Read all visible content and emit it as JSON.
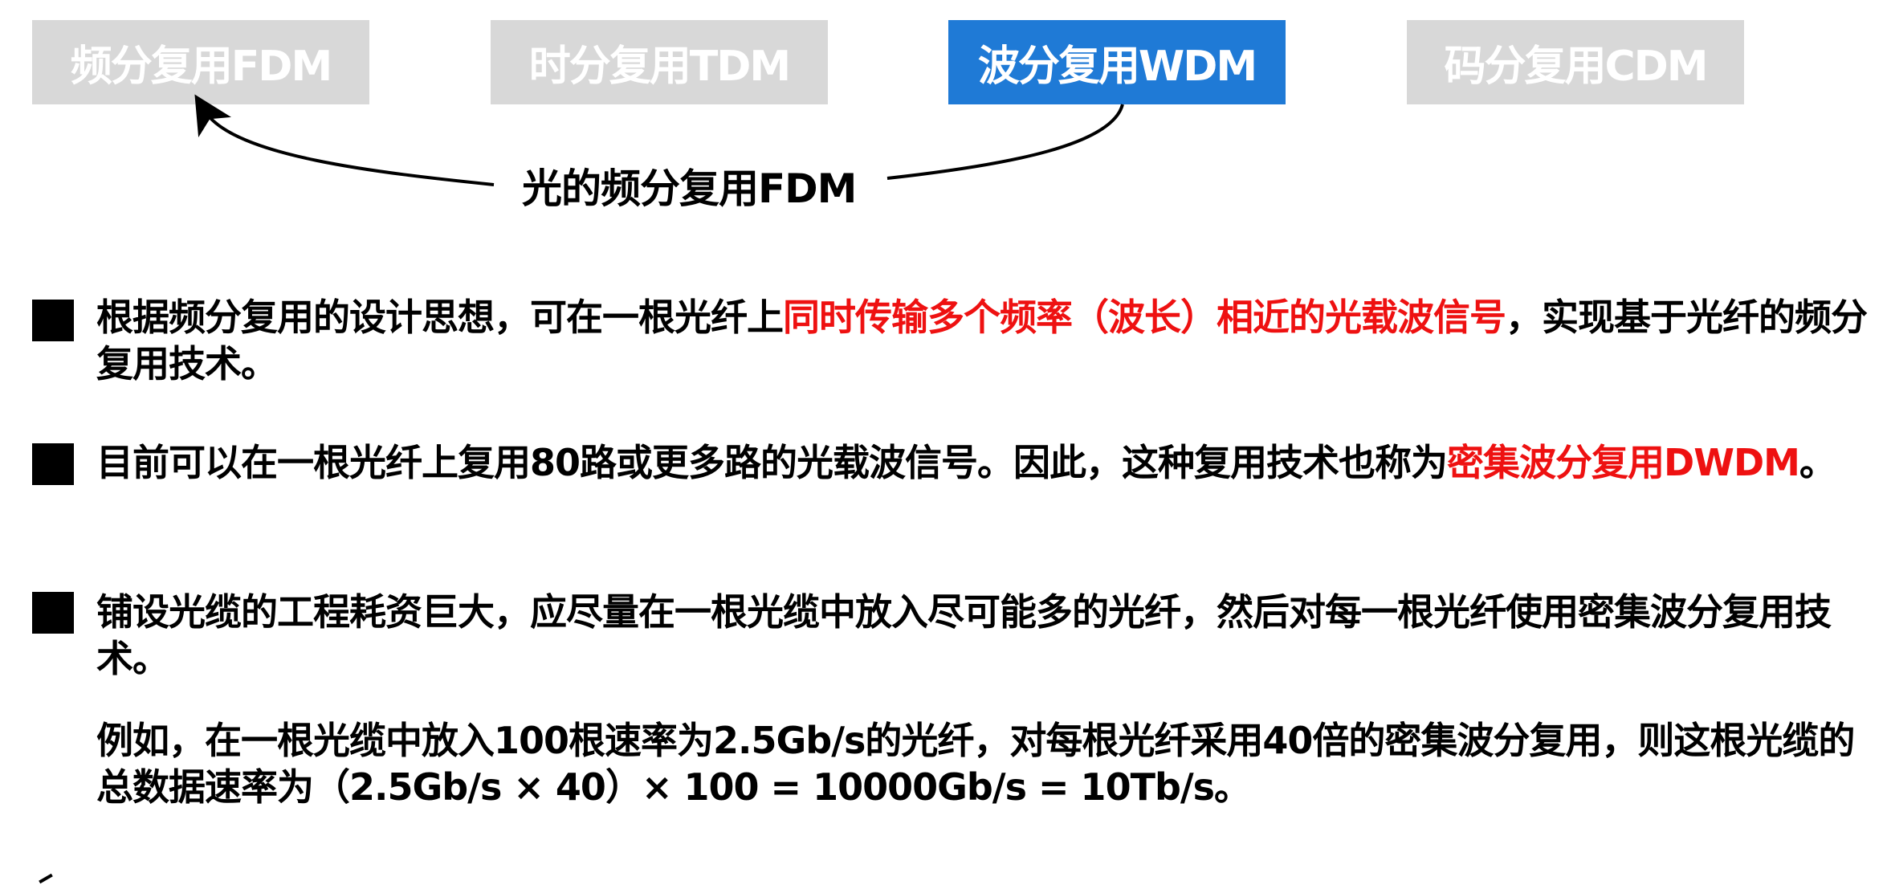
{
  "tabs": [
    {
      "label": "频分复用FDM",
      "active": false
    },
    {
      "label": "时分复用TDM",
      "active": false
    },
    {
      "label": "波分复用WDM",
      "active": true
    },
    {
      "label": "码分复用CDM",
      "active": false
    }
  ],
  "arrow_label": "光的频分复用FDM",
  "colors": {
    "tab_inactive_bg": "#d8d8d8",
    "tab_active_bg": "#1f7ad6",
    "highlight_red": "#ee1111"
  },
  "paragraphs": {
    "p1": {
      "before": "根据频分复用的设计思想，可在一根光纤上",
      "highlight": "同时传输多个频率（波长）相近的光载波信号",
      "after": "，实现基于光纤的频分复用技术。"
    },
    "p2": {
      "before": "目前可以在一根光纤上复用80路或更多路的光载波信号。因此，这种复用技术也称为",
      "highlight": "密集波分复用DWDM",
      "after": "。"
    },
    "p3": {
      "text": "铺设光缆的工程耗资巨大，应尽量在一根光缆中放入尽可能多的光纤，然后对每一根光纤使用密集波分复用技术。"
    },
    "p4": {
      "text": "例如，在一根光缆中放入100根速率为2.5Gb/s的光纤，对每根光纤采用40倍的密集波分复用，则这根光缆的总数据速率为（2.5Gb/s × 40）× 100 = 10000Gb/s = 10Tb/s。"
    }
  }
}
